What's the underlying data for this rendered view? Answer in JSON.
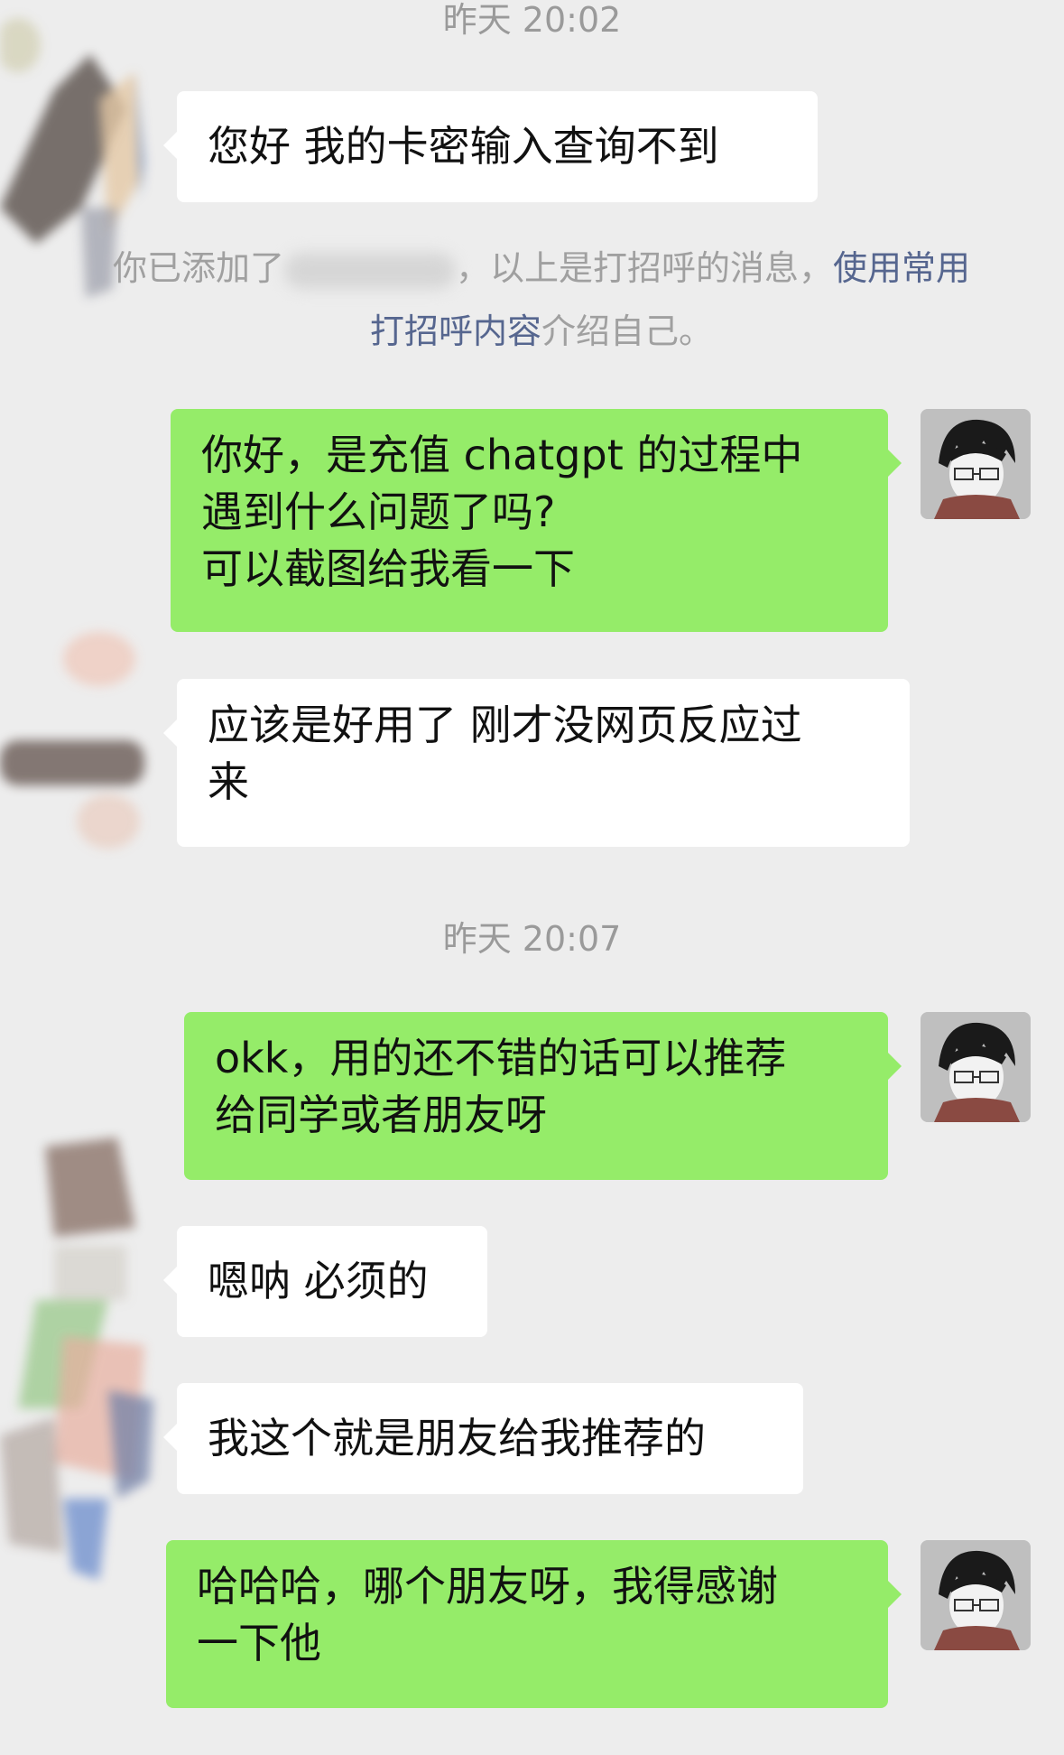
{
  "timestamps": [
    "昨天 20:02",
    "昨天 20:07"
  ],
  "system_notice": {
    "prefix": "你已添加了",
    "middle": "，以上是打招呼的消息，",
    "link_part1": "使用常用",
    "link_part2_pre": "打招呼",
    "link_part2": "内容",
    "suffix": "介绍自己。"
  },
  "messages": [
    {
      "side": "in",
      "text": "您好 我的卡密输入查询不到"
    },
    {
      "side": "out",
      "text": "你好，是充值 chatgpt 的过程中\n遇到什么问题了吗?\n可以截图给我看一下"
    },
    {
      "side": "in",
      "text": "应该是好用了 刚才没网页反应过\n来"
    },
    {
      "side": "out",
      "text": "okk，用的还不错的话可以推荐\n给同学或者朋友呀"
    },
    {
      "side": "in",
      "text": "嗯呐 必须的"
    },
    {
      "side": "in",
      "text": "我这个就是朋友给我推荐的"
    },
    {
      "side": "out",
      "text": "哈哈哈，哪个朋友呀，我得感谢\n一下他"
    }
  ],
  "colors": {
    "background": "#ededed",
    "outgoing_bubble": "#95ec69",
    "incoming_bubble": "#ffffff",
    "link": "#56668f"
  },
  "icons": [
    "own-avatar-icon",
    "contact-avatar-blurred"
  ]
}
